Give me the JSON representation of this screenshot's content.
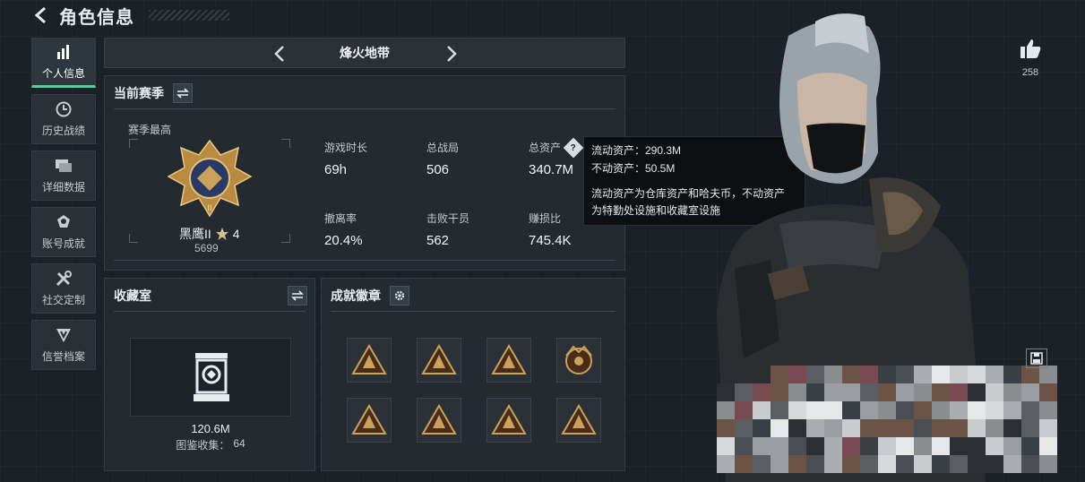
{
  "header": {
    "title": "角色信息"
  },
  "sidebar": {
    "items": [
      {
        "label": "个人信息",
        "icon": "bar-chart-icon",
        "active": true
      },
      {
        "label": "历史战绩",
        "icon": "clock-icon"
      },
      {
        "label": "详细数据",
        "icon": "cards-icon"
      },
      {
        "label": "账号成就",
        "icon": "trophy-icon"
      },
      {
        "label": "社交定制",
        "icon": "tools-icon"
      },
      {
        "label": "信誉档案",
        "icon": "shield-icon"
      }
    ]
  },
  "mode": {
    "name": "烽火地带"
  },
  "season": {
    "title": "当前赛季",
    "best_label": "赛季最高",
    "rank_name": "黑鹰II",
    "rank_stars": "4",
    "rank_points": "5699",
    "stats": [
      {
        "label": "游戏时长",
        "value": "69h"
      },
      {
        "label": "总战局",
        "value": "506"
      },
      {
        "label": "总资产",
        "value": "340.7M"
      },
      {
        "label": "撤离率",
        "value": "20.4%"
      },
      {
        "label": "击败干员",
        "value": "562"
      },
      {
        "label": "赚损比",
        "value": "745.4K"
      }
    ]
  },
  "tooltip": {
    "liquid": "流动资产：290.3M",
    "fixed": "不动资产：50.5M",
    "desc_line1": "流动资产为仓库资产和哈夫币，不动资产",
    "desc_line2": "为特勤处设施和收藏室设施"
  },
  "collection": {
    "title": "收藏室",
    "value": "120.6M",
    "count_label": "图鉴收集：",
    "count": "64"
  },
  "badges": {
    "title": "成就徽章",
    "count": 8
  },
  "likes": {
    "count": "258"
  },
  "colors": {
    "accent_green": "#4fd39a",
    "badge_gold": "#c9a35a",
    "badge_dark": "#4a2c1a"
  }
}
